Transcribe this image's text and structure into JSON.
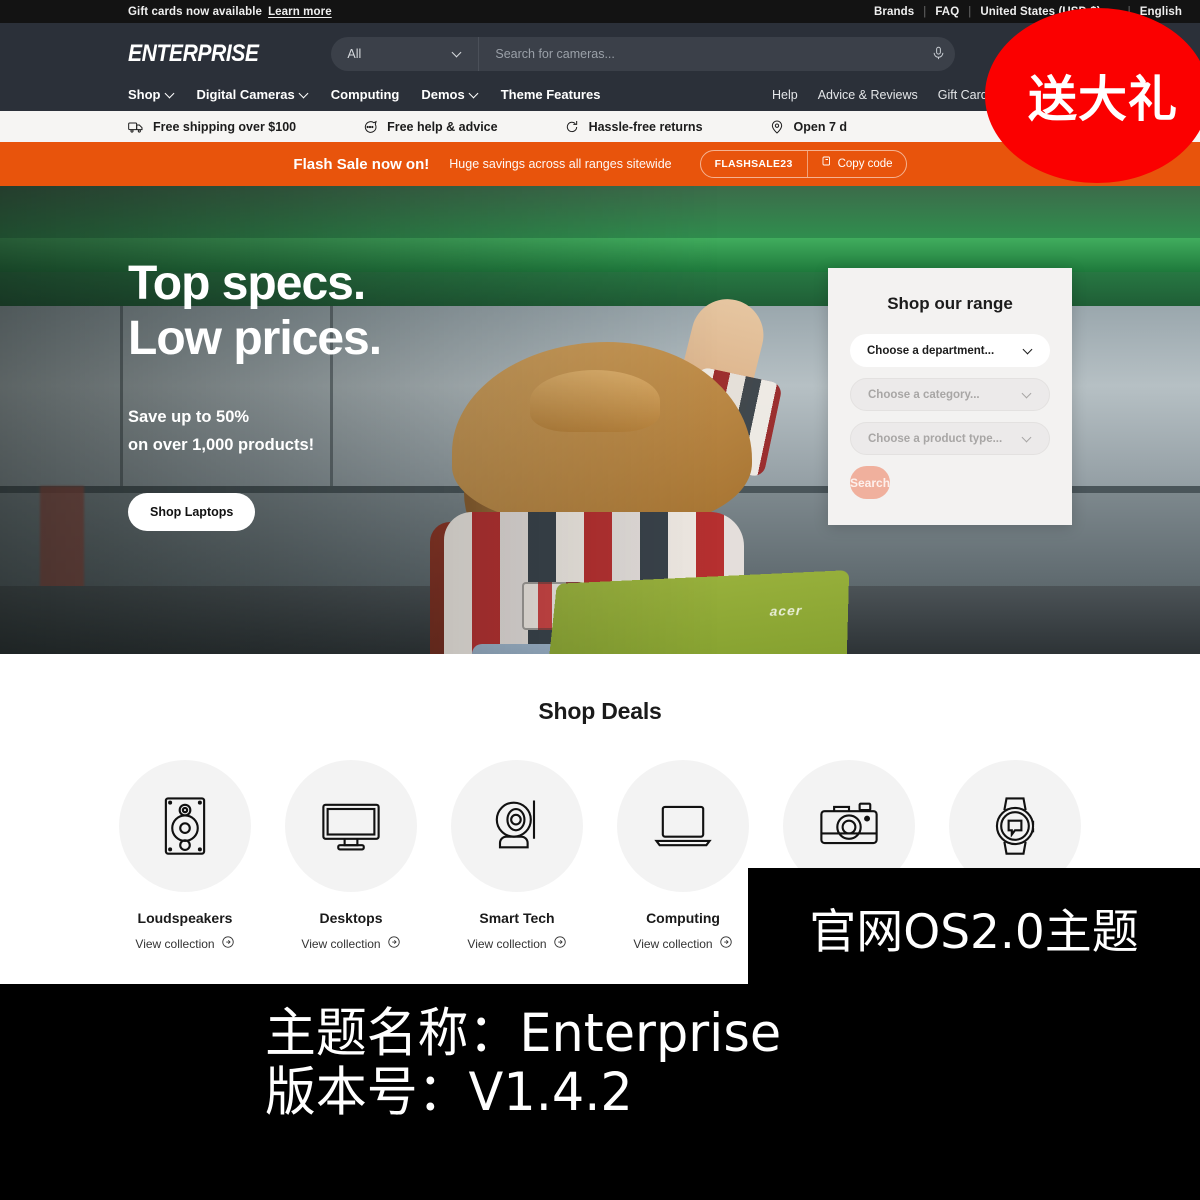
{
  "topbar": {
    "gift_text": "Gift cards now available",
    "gift_link": "Learn more",
    "links": [
      "Brands",
      "FAQ"
    ],
    "country": "United States (USD $)",
    "language": "English"
  },
  "header": {
    "logo": "ENTERPRISE",
    "search": {
      "category": "All",
      "placeholder": "Search for cameras...",
      "value": ""
    },
    "nav_primary": [
      {
        "label": "Shop",
        "has_dropdown": true
      },
      {
        "label": "Digital Cameras",
        "has_dropdown": true
      },
      {
        "label": "Computing",
        "has_dropdown": false
      },
      {
        "label": "Demos",
        "has_dropdown": true
      },
      {
        "label": "Theme Features",
        "has_dropdown": false
      }
    ],
    "nav_secondary": [
      "Help",
      "Advice & Reviews",
      "Gift Cards"
    ]
  },
  "announcements": [
    {
      "icon": "truck-icon",
      "label": "Free shipping over $100"
    },
    {
      "icon": "chat-icon",
      "label": "Free help & advice"
    },
    {
      "icon": "return-arrow-icon",
      "label": "Hassle-free returns"
    },
    {
      "icon": "location-pin-icon",
      "label": "Open 7 d"
    }
  ],
  "promo": {
    "title": "Flash Sale now on!",
    "subtitle": "Huge savings across all ranges sitewide",
    "code": "FLASHSALE23",
    "copy_label": "Copy code",
    "bg_color": "#e8540c"
  },
  "hero": {
    "heading_line1": "Top specs.",
    "heading_line2": "Low prices.",
    "sub_line1": "Save up to 50%",
    "sub_line2": "on over 1,000 products!",
    "cta": "Shop Laptops",
    "laptop_brand": "acer"
  },
  "range_card": {
    "title": "Shop our range",
    "department": "Choose a department...",
    "category": "Choose a category...",
    "product_type": "Choose a product type...",
    "search_button": "Search",
    "button_color": "#f0b09d"
  },
  "deals": {
    "title": "Shop Deals",
    "link_label": "View collection",
    "items": [
      {
        "name": "Loudspeakers",
        "icon": "loudspeaker-icon"
      },
      {
        "name": "Desktops",
        "icon": "monitor-icon"
      },
      {
        "name": "Smart Tech",
        "icon": "security-camera-icon"
      },
      {
        "name": "Computing",
        "icon": "laptop-icon"
      },
      {
        "name": "",
        "icon": "camera-icon"
      },
      {
        "name": "",
        "icon": "smartwatch-icon"
      }
    ]
  },
  "watermarks": {
    "red_badge": "送大礼",
    "black_tag": "官网OS2.0主题",
    "banner_line1": "主题名称：Enterprise",
    "banner_line2": "版本号：V1.4.2"
  }
}
